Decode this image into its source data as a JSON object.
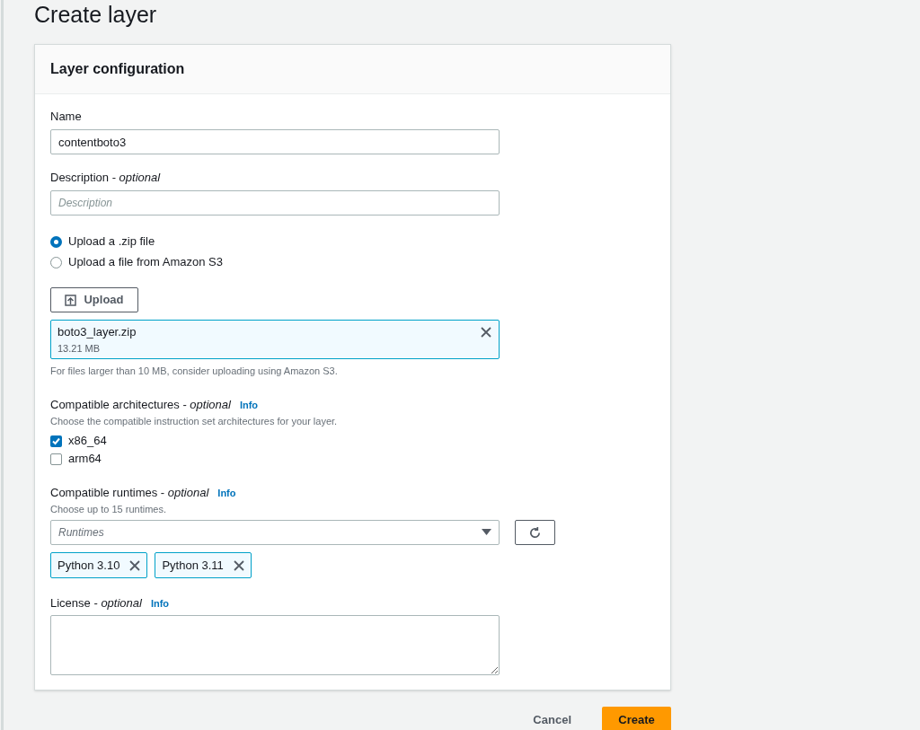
{
  "page_title": "Create layer",
  "panel": {
    "title": "Layer configuration",
    "name_field": {
      "label": "Name",
      "value": "contentboto3"
    },
    "description_field": {
      "label": "Description - *optional*",
      "placeholder": "Description"
    },
    "upload_source": [
      {
        "label": "Upload a .zip file",
        "selected": true
      },
      {
        "label": "Upload a file from Amazon S3",
        "selected": false
      }
    ],
    "upload_button": "Upload",
    "file": {
      "name": "boto3_layer.zip",
      "size": "13.21 MB"
    },
    "file_hint": "For files larger than 10 MB, consider uploading using Amazon S3.",
    "architectures": {
      "label": "Compatible architectures - *optional*",
      "info": "Info",
      "hint": "Choose the compatible instruction set architectures for your layer.",
      "options": [
        {
          "label": "x86_64",
          "checked": true
        },
        {
          "label": "arm64",
          "checked": false
        }
      ]
    },
    "runtimes": {
      "label": "Compatible runtimes - *optional*",
      "info": "Info",
      "hint": "Choose up to 15 runtimes.",
      "placeholder": "Runtimes",
      "tokens": [
        "Python 3.10",
        "Python 3.11"
      ]
    },
    "license": {
      "label": "License - *optional*",
      "info": "Info"
    }
  },
  "buttons": {
    "cancel": "Cancel",
    "create": "Create"
  }
}
